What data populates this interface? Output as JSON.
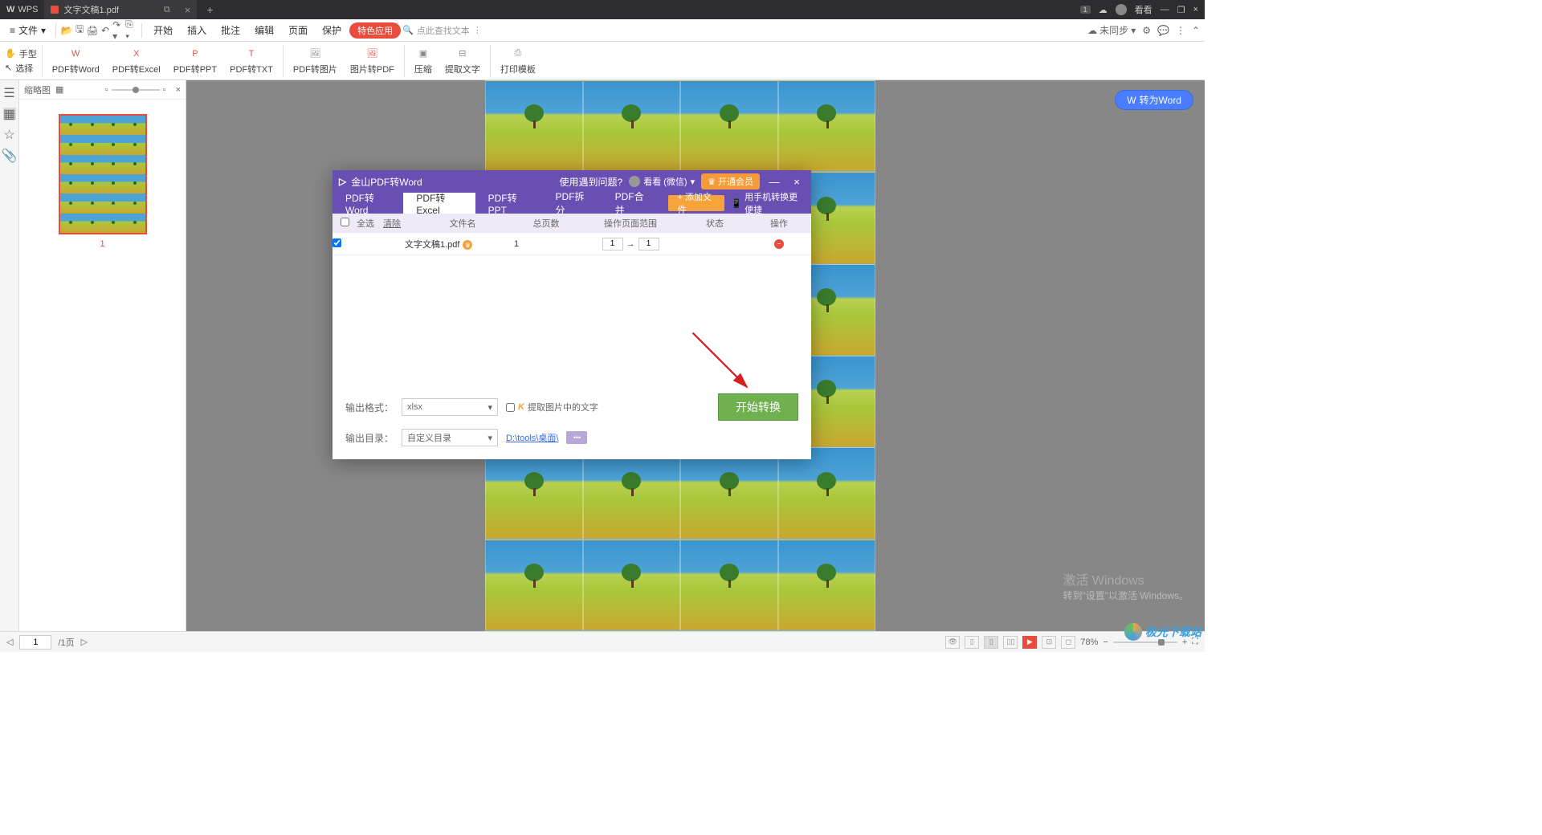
{
  "titlebar": {
    "app": "WPS",
    "tab_name": "文字文稿1.pdf",
    "badge": "1",
    "user": "看看"
  },
  "menubar": {
    "file": "文件",
    "items": [
      "开始",
      "插入",
      "批注",
      "编辑",
      "页面",
      "保护"
    ],
    "special": "特色应用",
    "search_placeholder": "点此查找文本",
    "sync": "未同步"
  },
  "ribbon": {
    "hand": "手型",
    "select": "选择",
    "tools": [
      "PDF转Word",
      "PDF转Excel",
      "PDF转PPT",
      "PDF转TXT",
      "PDF转图片",
      "图片转PDF",
      "压缩",
      "提取文字",
      "打印模板"
    ]
  },
  "thumbpanel": {
    "title": "缩略图",
    "page_label": "1"
  },
  "wordbtn": "转为Word",
  "dialog": {
    "title": "金山PDF转Word",
    "help": "使用遇到问题?",
    "user": "看看 (微信)",
    "vip": "开通会员",
    "tabs": [
      "PDF转Word",
      "PDF转Excel",
      "PDF转PPT",
      "PDF拆分",
      "PDF合并"
    ],
    "addfile": "+ 添加文件",
    "mobile": "用手机转换更便捷",
    "cols": {
      "select_all": "全选",
      "clear": "清除",
      "name": "文件名",
      "pages": "总页数",
      "range": "操作页面范围",
      "status": "状态",
      "op": "操作"
    },
    "row": {
      "name": "文字文稿1.pdf",
      "pages": "1",
      "from": "1",
      "to": "1"
    },
    "foot": {
      "format_label": "输出格式：",
      "format_value": "xlsx",
      "ocr": "提取图片中的文字",
      "dir_label": "输出目录：",
      "dir_value": "自定义目录",
      "path": "D:\\tools\\桌面\\",
      "browse": "•••",
      "start": "开始转换"
    }
  },
  "watermark": {
    "l1": "激活 Windows",
    "l2": "转到\"设置\"以激活 Windows。"
  },
  "sitewm": "极光下载站",
  "statusbar": {
    "page": "1",
    "total": "/1页",
    "zoom": "78%"
  }
}
